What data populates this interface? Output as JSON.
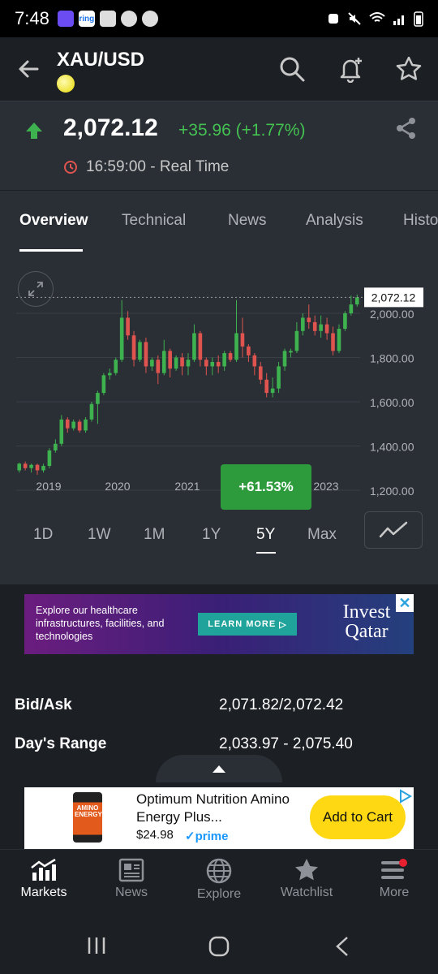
{
  "status": {
    "time": "7:48",
    "app_icons": [
      "app-icon",
      "ring",
      "gallery-icon",
      "app-icon",
      "app-icon"
    ]
  },
  "header": {
    "title": "XAU/USD"
  },
  "quote": {
    "price": "2,072.12",
    "change": "+35.96 (+1.77%)",
    "time": "16:59:00 - Real Time",
    "change_color": "#44c251"
  },
  "tabs": [
    {
      "label": "Overview",
      "active": true
    },
    {
      "label": "Technical"
    },
    {
      "label": "News"
    },
    {
      "label": "Analysis"
    },
    {
      "label": "Histo"
    }
  ],
  "chart_data": {
    "type": "candlestick",
    "x_ticks": [
      "2019",
      "2020",
      "2021",
      "2022",
      "2023"
    ],
    "y_ticks": [
      "2,000.00",
      "1,800.00",
      "1,600.00",
      "1,400.00",
      "1,200.00"
    ],
    "ylim": [
      1200,
      2100
    ],
    "last_price_label": "2,072.12",
    "change_badge": "+61.53%",
    "colors": {
      "up": "#3db24f",
      "down": "#e0544f"
    },
    "candles": [
      [
        1290,
        1320,
        1280,
        1325
      ],
      [
        1320,
        1300,
        1290,
        1330
      ],
      [
        1300,
        1315,
        1280,
        1320
      ],
      [
        1315,
        1290,
        1270,
        1320
      ],
      [
        1290,
        1310,
        1280,
        1320
      ],
      [
        1310,
        1380,
        1300,
        1390
      ],
      [
        1380,
        1410,
        1370,
        1430
      ],
      [
        1410,
        1520,
        1400,
        1540
      ],
      [
        1520,
        1480,
        1460,
        1530
      ],
      [
        1480,
        1510,
        1470,
        1520
      ],
      [
        1510,
        1470,
        1460,
        1520
      ],
      [
        1470,
        1520,
        1460,
        1530
      ],
      [
        1520,
        1590,
        1510,
        1600
      ],
      [
        1590,
        1640,
        1500,
        1650
      ],
      [
        1640,
        1720,
        1630,
        1730
      ],
      [
        1720,
        1730,
        1700,
        1750
      ],
      [
        1730,
        1790,
        1720,
        1800
      ],
      [
        1790,
        1980,
        1780,
        2060
      ],
      [
        1980,
        1900,
        1880,
        2010
      ],
      [
        1900,
        1790,
        1760,
        1920
      ],
      [
        1790,
        1870,
        1780,
        1880
      ],
      [
        1870,
        1760,
        1730,
        1890
      ],
      [
        1760,
        1790,
        1740,
        1800
      ],
      [
        1790,
        1730,
        1680,
        1810
      ],
      [
        1730,
        1830,
        1720,
        1880
      ],
      [
        1830,
        1750,
        1710,
        1840
      ],
      [
        1750,
        1800,
        1740,
        1810
      ],
      [
        1800,
        1760,
        1720,
        1820
      ],
      [
        1760,
        1790,
        1720,
        1820
      ],
      [
        1790,
        1910,
        1780,
        1950
      ],
      [
        1910,
        1790,
        1760,
        1920
      ],
      [
        1790,
        1760,
        1720,
        1800
      ],
      [
        1760,
        1780,
        1720,
        1800
      ],
      [
        1780,
        1760,
        1730,
        1810
      ],
      [
        1760,
        1820,
        1740,
        1830
      ],
      [
        1820,
        1790,
        1780,
        1830
      ],
      [
        1790,
        1910,
        1780,
        2060
      ],
      [
        1910,
        1850,
        1800,
        1980
      ],
      [
        1850,
        1810,
        1780,
        1860
      ],
      [
        1810,
        1760,
        1720,
        1820
      ],
      [
        1760,
        1700,
        1680,
        1780
      ],
      [
        1700,
        1640,
        1620,
        1730
      ],
      [
        1640,
        1660,
        1620,
        1710
      ],
      [
        1660,
        1760,
        1640,
        1780
      ],
      [
        1760,
        1830,
        1740,
        1840
      ],
      [
        1830,
        1830,
        1800,
        1840
      ],
      [
        1830,
        1920,
        1820,
        1960
      ],
      [
        1920,
        1980,
        1900,
        2000
      ],
      [
        1980,
        1960,
        1930,
        2040
      ],
      [
        1960,
        1920,
        1900,
        1990
      ],
      [
        1920,
        1950,
        1890,
        1990
      ],
      [
        1950,
        1910,
        1880,
        1980
      ],
      [
        1910,
        1830,
        1810,
        1940
      ],
      [
        1830,
        1930,
        1820,
        1950
      ],
      [
        1930,
        2000,
        1920,
        2010
      ],
      [
        2000,
        2040,
        1990,
        2080
      ],
      [
        2040,
        2072,
        2030,
        2085
      ]
    ]
  },
  "time_ranges": [
    {
      "label": "1D"
    },
    {
      "label": "1W"
    },
    {
      "label": "1M"
    },
    {
      "label": "1Y"
    },
    {
      "label": "5Y",
      "active": true
    },
    {
      "label": "Max"
    }
  ],
  "ad_banner": {
    "text": "Explore our healthcare infrastructures, facilities, and technologies",
    "button": "LEARN MORE",
    "brand": "Invest Qatar",
    "close": "✕"
  },
  "stats": [
    {
      "label": "Bid/Ask",
      "value": "2,071.82/2,072.42"
    },
    {
      "label": "Day's Range",
      "value": "2,033.97 - 2,075.40"
    }
  ],
  "product_ad": {
    "image_label": "AMINO ENERGY",
    "title": "Optimum Nutrition Amino Energy Plus...",
    "price": "$24.98",
    "prime": "prime",
    "button": "Add to Cart"
  },
  "bottom_nav": [
    {
      "label": "Markets",
      "icon": "markets-icon",
      "active": true
    },
    {
      "label": "News",
      "icon": "news-icon"
    },
    {
      "label": "Explore",
      "icon": "globe-icon"
    },
    {
      "label": "Watchlist",
      "icon": "star-icon"
    },
    {
      "label": "More",
      "icon": "menu-icon"
    }
  ]
}
